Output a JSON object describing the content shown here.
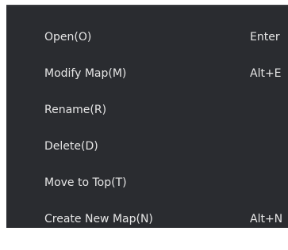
{
  "context_menu": {
    "items": [
      {
        "label": "Open(O)",
        "shortcut": "Enter"
      },
      {
        "label": "Modify Map(M)",
        "shortcut": "Alt+E"
      },
      {
        "label": "Rename(R)",
        "shortcut": ""
      },
      {
        "label": "Delete(D)",
        "shortcut": ""
      },
      {
        "label": "Move to Top(T)",
        "shortcut": ""
      },
      {
        "label": "Create New Map(N)",
        "shortcut": "Alt+N"
      }
    ]
  },
  "colors": {
    "menu_background": "#2a2c30",
    "menu_text": "#e6e6e6",
    "page_background": "#ffffff"
  }
}
